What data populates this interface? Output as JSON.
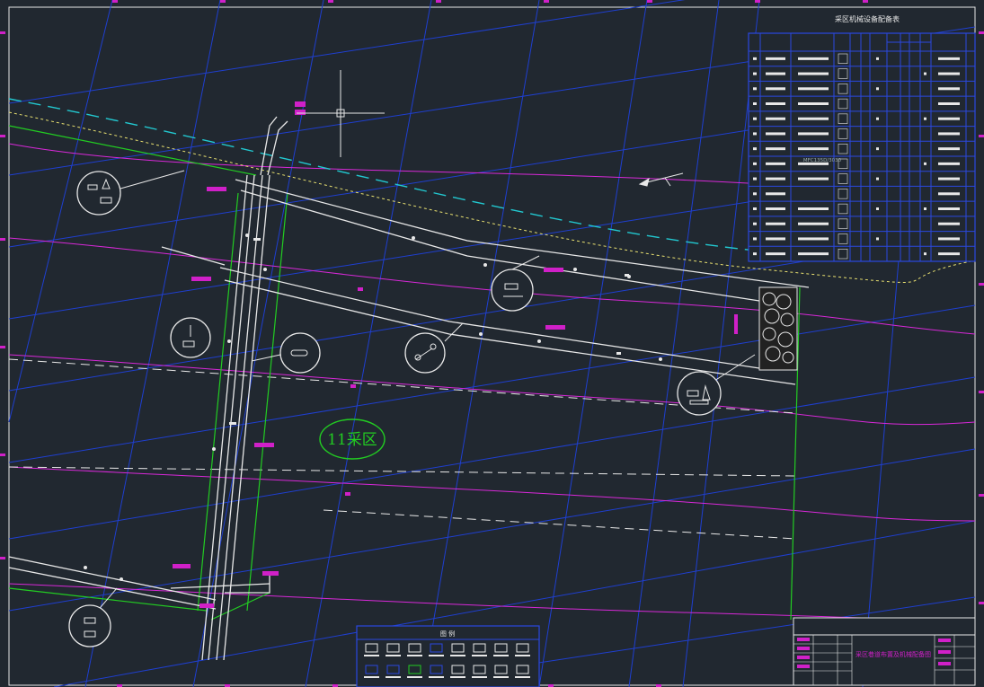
{
  "drawing": {
    "area_label": "11采区",
    "equipment_table_title": "采区机械设备配备表",
    "equipment_table_rowcount": 14,
    "equipment_model_visible": "MFC135D/3030",
    "legend_title": "图 例",
    "titleblock_caption": "采区巷道布置及机械配备图"
  },
  "colors": {
    "background": "#212830",
    "grid": "#1f3fd0",
    "roadway": "#e8e8e8",
    "contour": "#d828d8",
    "boundary": "#22cc22",
    "cyan_dash": "#22c8d0",
    "yellow_dash": "#e8e070",
    "tag": "#d020c8",
    "frame": "#2a48e0"
  },
  "icons": {
    "crosshair": "cursor-crosshair-icon",
    "compass": "north-arrow-icon",
    "callouts": "equipment-callout-icon",
    "rock": "goaf-rubble-icon"
  }
}
